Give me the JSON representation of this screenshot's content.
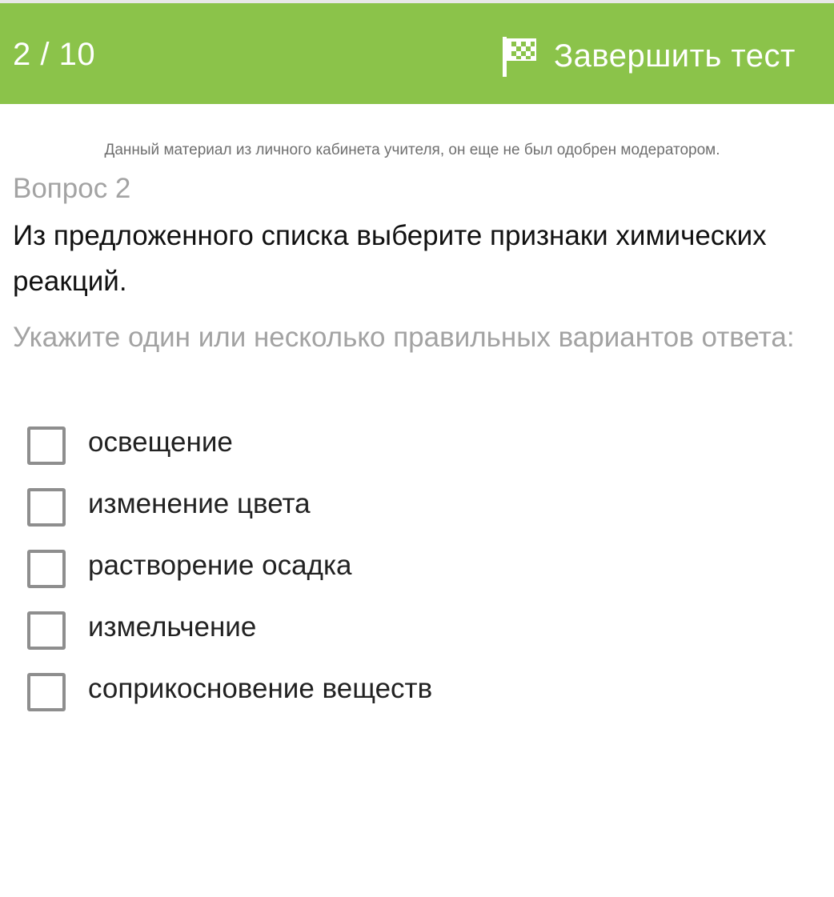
{
  "header": {
    "counter": "2 / 10",
    "finish_label": "Завершить тест",
    "finish_icon": "checkered-flag-icon",
    "background_color": "#8bc34a"
  },
  "notice": "Данный материал из личного кабинета учителя, он еще не был одобрен модератором.",
  "question": {
    "number_label": "Вопрос 2",
    "text": "Из предложенного списка выберите признаки химических реакций.",
    "instruction": "Укажите один или несколько правильных вариантов ответа:"
  },
  "options": [
    {
      "label": "освещение",
      "checked": false
    },
    {
      "label": "изменение цвета",
      "checked": false
    },
    {
      "label": "растворение осадка",
      "checked": false
    },
    {
      "label": "измельчение",
      "checked": false
    },
    {
      "label": "соприкосновение веществ",
      "checked": false
    }
  ]
}
